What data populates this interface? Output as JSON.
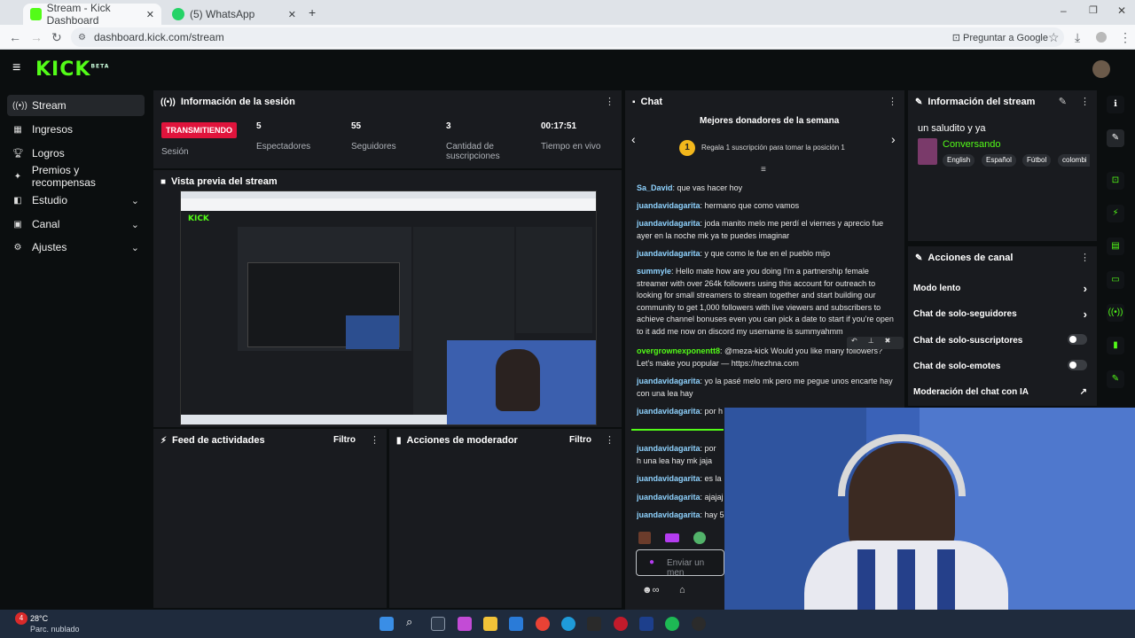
{
  "browser": {
    "tabs": [
      {
        "label": "Stream - Kick Dashboard",
        "active": true
      },
      {
        "label": "(5) WhatsApp",
        "active": false
      }
    ],
    "url": "dashboard.kick.com/stream",
    "ask_google": "Preguntar a Google"
  },
  "header": {
    "logo": "KICK",
    "logo_sup": "BETA"
  },
  "sidebar": {
    "items": [
      {
        "label": "Stream",
        "icon": "stream-icon"
      },
      {
        "label": "Ingresos",
        "icon": "money-icon"
      },
      {
        "label": "Logros",
        "icon": "trophy-icon"
      },
      {
        "label": "Premios y recompensas",
        "icon": "gift-icon"
      },
      {
        "label": "Estudio",
        "icon": "studio-icon"
      },
      {
        "label": "Canal",
        "icon": "channel-icon"
      },
      {
        "label": "Ajustes",
        "icon": "gear-icon"
      }
    ]
  },
  "session": {
    "title": "Información de la sesión",
    "live_badge": "TRANSMITIENDO",
    "session_label": "Sesión",
    "stats": [
      {
        "value": "5",
        "label": "Espectadores"
      },
      {
        "value": "55",
        "label": "Seguidores"
      },
      {
        "value": "3",
        "label": "Cantidad de suscripciones"
      },
      {
        "value": "00:17:51",
        "label": "Tiempo en vivo"
      }
    ]
  },
  "preview": {
    "title": "Vista previa del stream"
  },
  "activity": {
    "title": "Feed de actividades",
    "filter": "Filtro"
  },
  "modactions": {
    "title": "Acciones de moderador",
    "filter": "Filtro"
  },
  "chat": {
    "title": "Chat",
    "donors_title": "Mejores donadores de la semana",
    "donor_rank": "1",
    "donor_text": "Regala 1 suscripción para tomar la posición 1",
    "input_placeholder": "Enviar un men",
    "messages": [
      {
        "user": "Sa_David",
        "text": ": que vas hacer hoy"
      },
      {
        "user": "juandavidagarita",
        "text": ": hermano que como vamos"
      },
      {
        "user": "juandavidagarita",
        "text": ": joda manito melo me perdí el viernes y aprecio fue ayer en la noche mk ya te puedes imaginar"
      },
      {
        "user": "juandavidagarita",
        "text": ": y que como le fue en el pueblo mijo"
      },
      {
        "user": "summyle",
        "text": ": Hello mate how are you doing I'm a partnership female streamer with over 264k followers using this account for outreach to looking for small streamers to stream together and start building our community to get 1,000 followers with live viewers and subscribers to achieve channel bonuses even you can pick a date to start if you're open to it add me now on discord my username is summyahmm"
      },
      {
        "user": "overgrownexponentt8",
        "text": ": @meza-kick Would you like many followers? Let's make you popular — https://nezhna.com"
      },
      {
        "user": "juandavidagarita",
        "text": ": yo la pasé melo mk pero me pegue unos encarte hay con una lea hay"
      },
      {
        "user": "juandavidagarita",
        "text": ": por h"
      },
      {
        "user": "juandavidagarita",
        "text": ": por h una lea hay mk jaja"
      },
      {
        "user": "juandavidagarita",
        "text": ": es la"
      },
      {
        "user": "juandavidagarita",
        "text": ": ajajaj"
      },
      {
        "user": "juandavidagarita",
        "text": ": hay 5"
      }
    ]
  },
  "stream_info": {
    "title": "Información del stream",
    "stream_title": "un saludito y ya",
    "category": "Conversando",
    "tags": [
      "English",
      "Español",
      "Fútbol",
      "colombi"
    ]
  },
  "channel_actions": {
    "title": "Acciones de canal",
    "items": [
      {
        "label": "Modo lento",
        "control": "chevron"
      },
      {
        "label": "Chat de solo-seguidores",
        "control": "chevron"
      },
      {
        "label": "Chat de solo-suscriptores",
        "control": "toggle"
      },
      {
        "label": "Chat de solo-emotes",
        "control": "toggle"
      },
      {
        "label": "Moderación del chat con IA",
        "control": "external"
      }
    ]
  },
  "taskbar": {
    "temp": "28°C",
    "weather": "Parc. nublado",
    "badge": "4"
  },
  "colors": {
    "accent": "#53fc18",
    "live": "#e0143c",
    "panel": "#191b1f",
    "bg": "#0b0e0f"
  }
}
